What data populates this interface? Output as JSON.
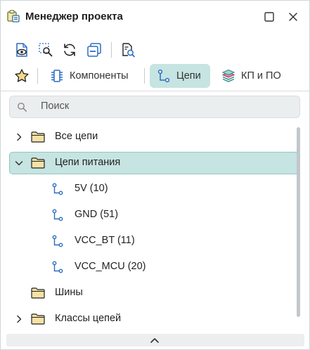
{
  "window": {
    "title": "Менеджер проекта"
  },
  "tabs": [
    {
      "label": "Компоненты",
      "active": false
    },
    {
      "label": "Цепи",
      "active": true
    },
    {
      "label": "КП и ПО",
      "active": false
    }
  ],
  "search": {
    "placeholder": "Поиск",
    "value": ""
  },
  "tree": [
    {
      "label": "Все цепи",
      "kind": "folder",
      "expanded": false,
      "has_children": true
    },
    {
      "label": "Цепи питания",
      "kind": "folder",
      "expanded": true,
      "selected": true,
      "has_children": true
    },
    {
      "label": "5V (10)",
      "kind": "net"
    },
    {
      "label": "GND (51)",
      "kind": "net"
    },
    {
      "label": "VCC_BT (11)",
      "kind": "net"
    },
    {
      "label": "VCC_MCU (20)",
      "kind": "net"
    },
    {
      "label": "Шины",
      "kind": "folder",
      "has_children": false
    },
    {
      "label": "Классы цепей",
      "kind": "folder",
      "expanded": false,
      "has_children": true
    }
  ],
  "colors": {
    "accent": "#2f8f88",
    "selection": "#c6e4e1",
    "icon_blue": "#2a6cc0"
  }
}
